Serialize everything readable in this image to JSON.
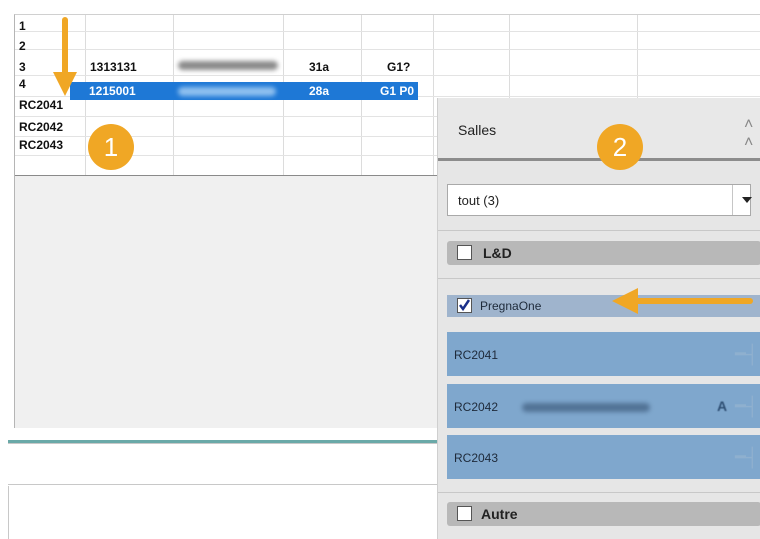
{
  "grid": {
    "rows": [
      {
        "label": "1"
      },
      {
        "label": "2"
      },
      {
        "label": "3",
        "cells": [
          "1313131",
          "31a",
          "G1?"
        ]
      },
      {
        "label": "4"
      },
      {
        "label": "RC2041",
        "cells": [
          "1215001",
          "28a",
          "G1 P0"
        ],
        "selected": true
      },
      {
        "label": "RC2042"
      },
      {
        "label": "RC2043"
      }
    ]
  },
  "badges": {
    "first": "1",
    "second": "2"
  },
  "side_panel": {
    "title": "Salles",
    "filter_value": "tout (3)",
    "groups": [
      {
        "label": "L&D",
        "checked": false
      },
      {
        "label": "PregnaOne",
        "checked": true
      },
      {
        "label": "Autre",
        "checked": false
      }
    ],
    "rooms": [
      {
        "name": "RC2041"
      },
      {
        "name": "RC2042",
        "status": "A"
      },
      {
        "name": "RC2043"
      }
    ]
  },
  "colors": {
    "accent": "#f0a725",
    "selection": "#1e78d6",
    "room_card": "#7fa7cd"
  },
  "icons": [
    "arrow-down-icon",
    "arrow-left-icon",
    "collapse-up-icon",
    "chevron-down-icon",
    "pin-icon",
    "checkmark-icon"
  ]
}
